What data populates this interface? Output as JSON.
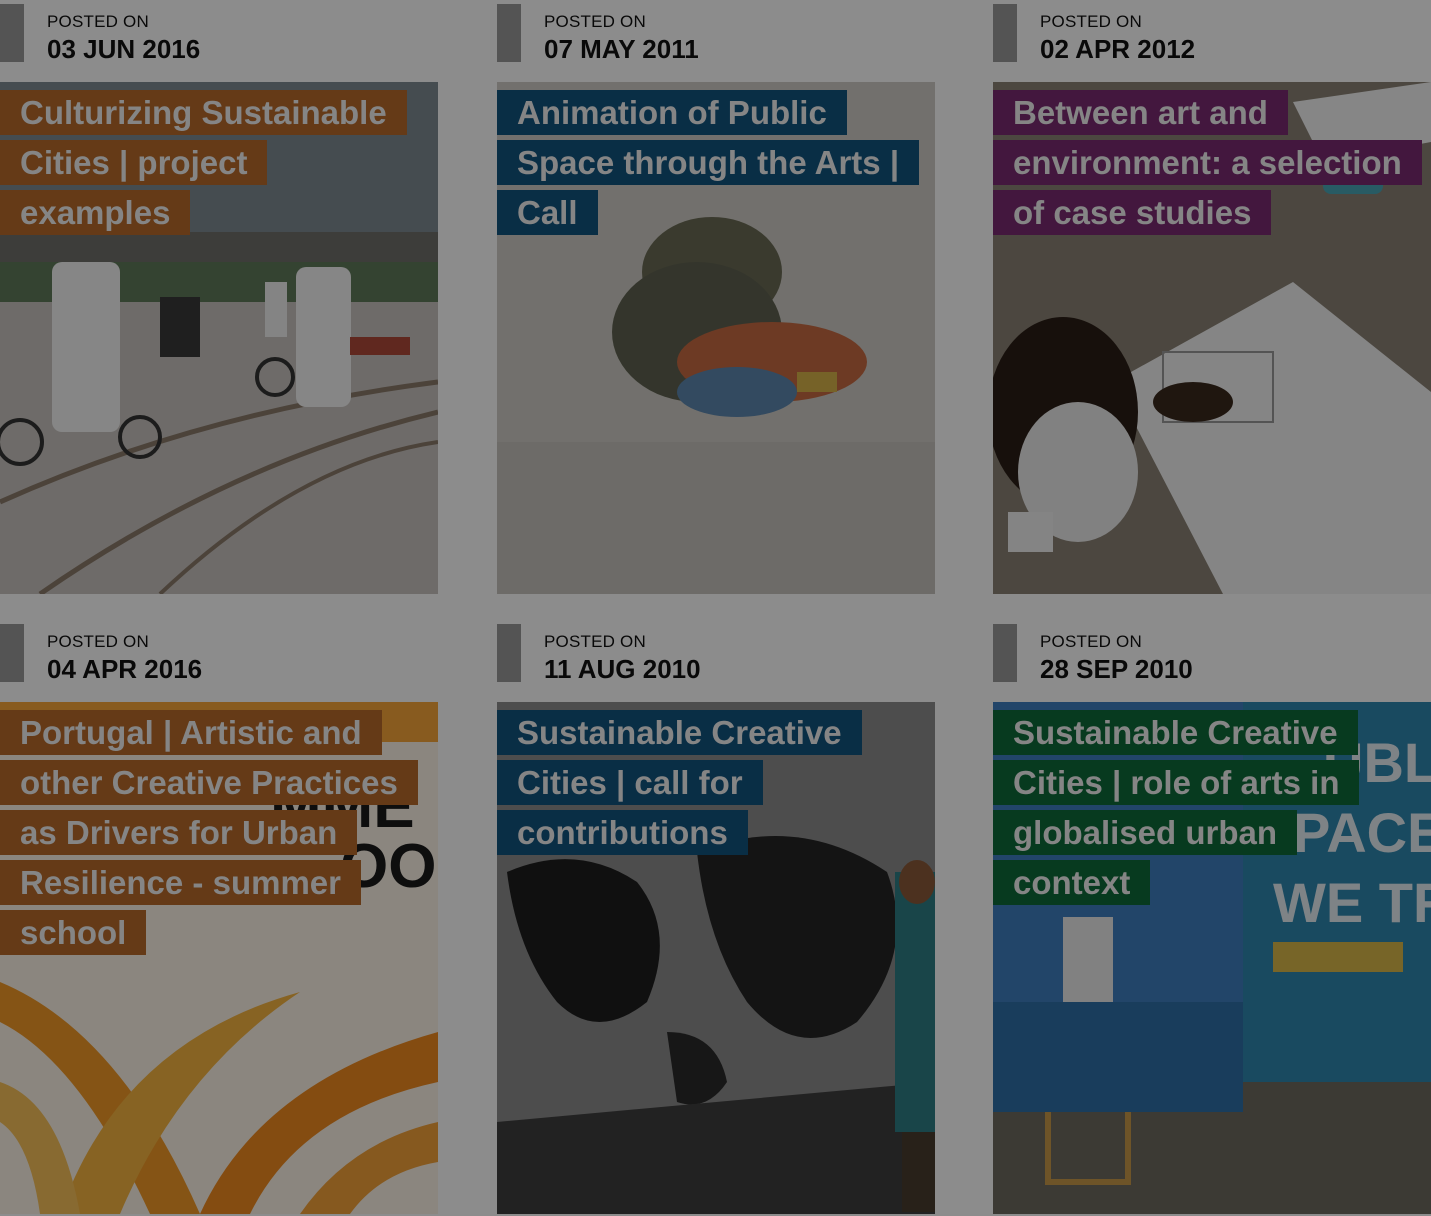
{
  "posts": [
    {
      "posted_label": "POSTED ON",
      "date": "03 JUN 2016",
      "title": "Culturizing Sustainable Cities | project examples",
      "tag_color": "#b86a2b"
    },
    {
      "posted_label": "POSTED ON",
      "date": "07 MAY 2011",
      "title": "Animation of Public Space through the Arts | Call",
      "tag_color": "#12547f"
    },
    {
      "posted_label": "POSTED ON",
      "date": "02 APR 2012",
      "title": "Between art and environment: a selection of case studies",
      "tag_color": "#7a2a72"
    },
    {
      "posted_label": "POSTED ON",
      "date": "04 APR 2016",
      "title": "Portugal | Artistic and other Creative Practices as Drivers for Urban Resilience - summer school",
      "tag_color": "#b86a2b"
    },
    {
      "posted_label": "POSTED ON",
      "date": "11 AUG 2010",
      "title": "Sustainable Creative Cities | call for contributions",
      "tag_color": "#12547f"
    },
    {
      "posted_label": "POSTED ON",
      "date": "28 SEP 2010",
      "title": "Sustainable Creative Cities | role of arts in globalised urban context",
      "tag_color": "#0e6b3a"
    }
  ],
  "thumbnails": [
    "street-bikes-photo",
    "blurred-person-photo",
    "children-drawing-photo",
    "festival-poster-image",
    "world-map-wall-photo",
    "public-space-container-photo"
  ]
}
